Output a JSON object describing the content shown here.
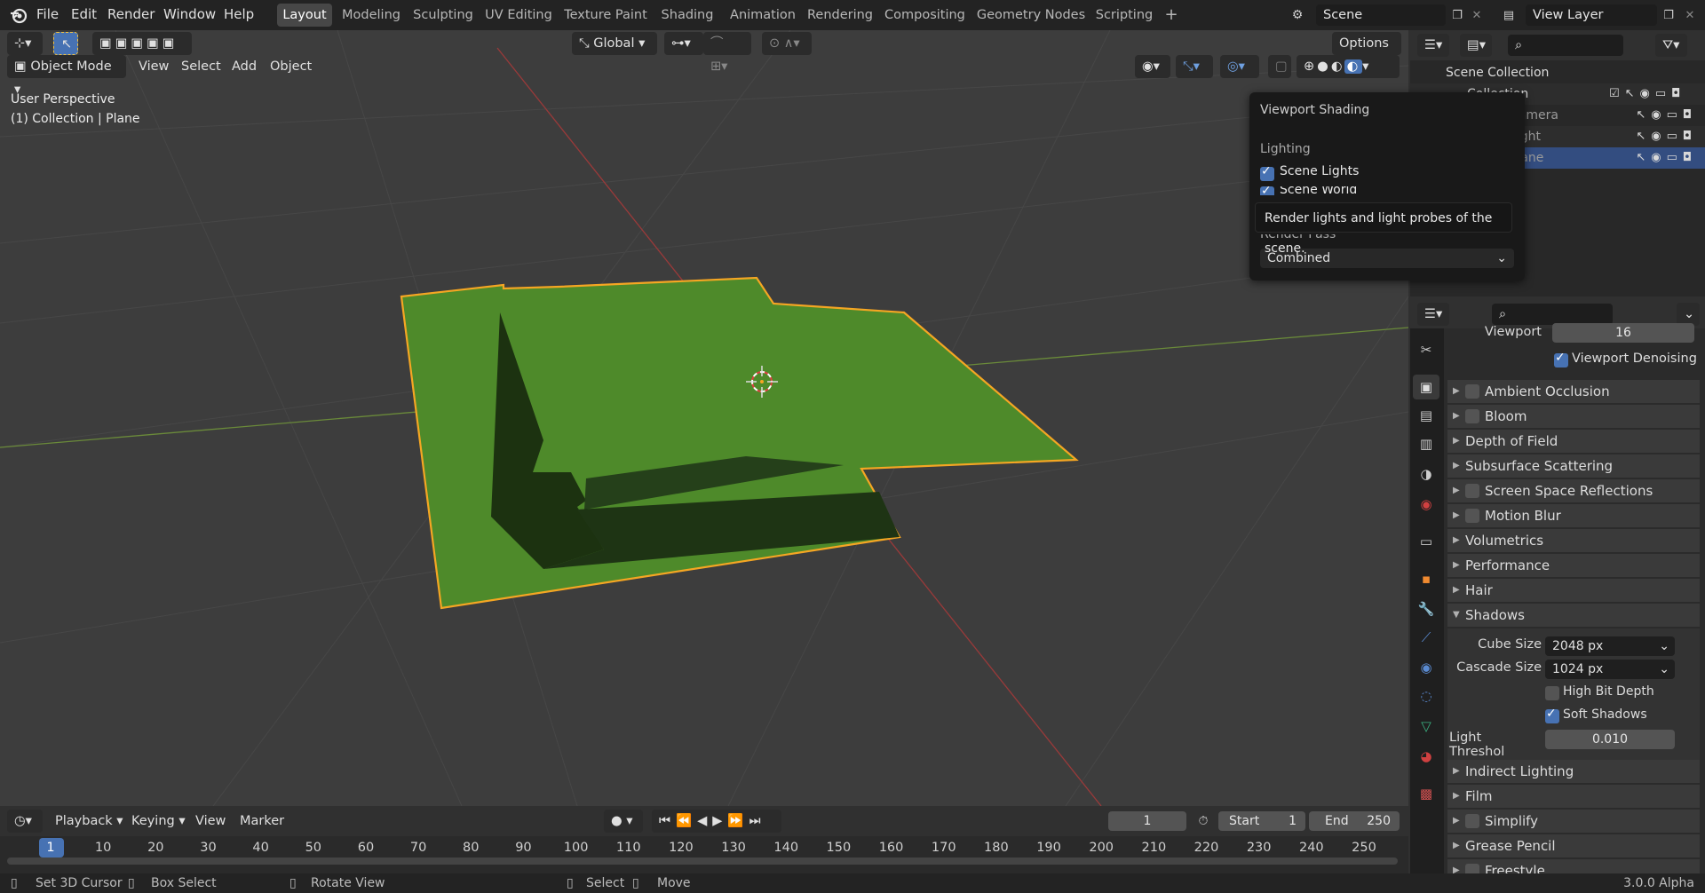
{
  "topbar": {
    "menus": [
      "File",
      "Edit",
      "Render",
      "Window",
      "Help"
    ],
    "workspaces": [
      "Layout",
      "Modeling",
      "Sculpting",
      "UV Editing",
      "Texture Paint",
      "Shading",
      "Animation",
      "Rendering",
      "Compositing",
      "Geometry Nodes",
      "Scripting"
    ],
    "active_workspace": "Layout",
    "add_tab": "+",
    "scene": "Scene",
    "view_layer": "View Layer"
  },
  "viewport": {
    "transform_orientation": "Global",
    "options_label": "Options",
    "mode": "Object Mode",
    "menus": [
      "View",
      "Select",
      "Add",
      "Object"
    ],
    "info_line1": "User Perspective",
    "info_line2": "(1) Collection | Plane",
    "accent_color": "#f5a623",
    "plane_color": "#4e8a2a"
  },
  "popover": {
    "title": "Viewport Shading",
    "section_lighting": "Lighting",
    "scene_lights": "Scene Lights",
    "scene_world": "Scene World",
    "render_pass_label": "Render Pass",
    "render_pass_value": "Combined",
    "tooltip": "Render lights and light probes of the scene."
  },
  "outliner": {
    "scene_collection": "Scene Collection",
    "collection": "Collection",
    "items": [
      "Camera",
      "Light",
      "Plane"
    ]
  },
  "properties": {
    "viewport_label": "Viewport",
    "viewport_value": "16",
    "viewport_denoising": "Viewport Denoising",
    "panels_top": [
      "Ambient Occlusion",
      "Bloom",
      "Depth of Field",
      "Subsurface Scattering",
      "Screen Space Reflections",
      "Motion Blur",
      "Volumetrics",
      "Performance",
      "Hair",
      "Shadows"
    ],
    "cube_size_label": "Cube Size",
    "cube_size_value": "2048 px",
    "cascade_size_label": "Cascade Size",
    "cascade_size_value": "1024 px",
    "high_bit_depth": "High Bit Depth",
    "soft_shadows": "Soft Shadows",
    "light_threshold_label": "Light Threshol",
    "light_threshold_value": "0.010",
    "panels_bottom": [
      "Indirect Lighting",
      "Film",
      "Simplify",
      "Grease Pencil",
      "Freestyle"
    ]
  },
  "timeline": {
    "menus": [
      "Playback",
      "Keying",
      "View",
      "Marker"
    ],
    "current_frame": "1",
    "start_label": "Start",
    "start_value": "1",
    "end_label": "End",
    "end_value": "250",
    "ticks": [
      "1",
      "10",
      "20",
      "30",
      "40",
      "50",
      "60",
      "70",
      "80",
      "90",
      "100",
      "110",
      "120",
      "130",
      "140",
      "150",
      "160",
      "170",
      "180",
      "190",
      "200",
      "210",
      "220",
      "230",
      "240",
      "250"
    ]
  },
  "statusbar": {
    "set_cursor": "Set 3D Cursor",
    "box_select": "Box Select",
    "rotate_view": "Rotate View",
    "select": "Select",
    "move": "Move",
    "version": "3.0.0 Alpha"
  }
}
